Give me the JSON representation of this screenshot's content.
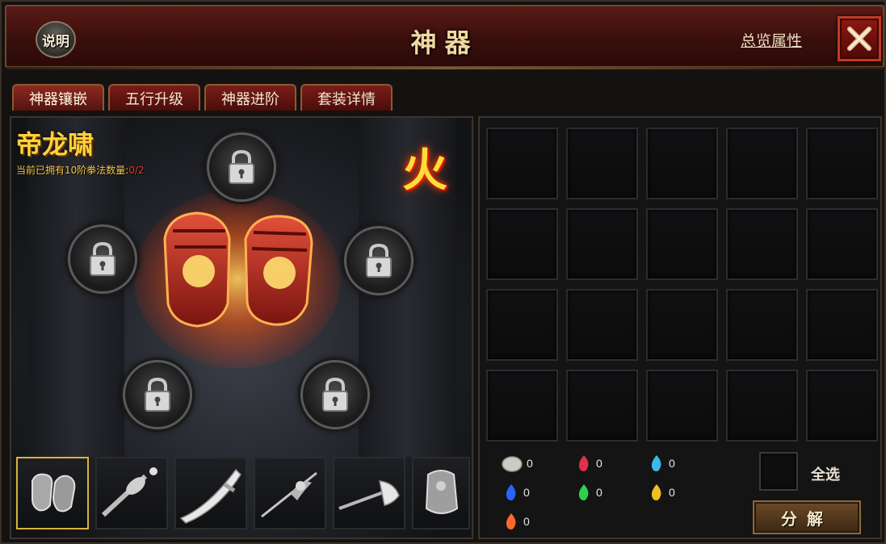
{
  "header": {
    "help_label": "说明",
    "title": "神器",
    "overview_link": "总览属性",
    "close_icon": "close-x-icon"
  },
  "tabs": [
    {
      "label": "神器镶嵌",
      "active": true
    },
    {
      "label": "五行升级",
      "active": false
    },
    {
      "label": "神器进阶",
      "active": false
    },
    {
      "label": "套装详情",
      "active": false
    }
  ],
  "artifact": {
    "name": "帝龙啸",
    "owned_prefix": "当前已拥有10阶拳法数量:",
    "owned_count": "0/2",
    "element": "火",
    "image_icon": "fire-gauntlets-icon",
    "sockets": [
      "lock-icon",
      "lock-icon",
      "lock-icon",
      "lock-icon",
      "lock-icon"
    ]
  },
  "thumbnails": [
    {
      "icon": "gauntlets-icon",
      "selected": true
    },
    {
      "icon": "mace-icon",
      "selected": false
    },
    {
      "icon": "blade-icon",
      "selected": false
    },
    {
      "icon": "staff-icon",
      "selected": false
    },
    {
      "icon": "axe-icon",
      "selected": false
    },
    {
      "icon": "armor-icon",
      "selected": false
    }
  ],
  "inventory": {
    "rows": 4,
    "cols": 5
  },
  "materials": [
    {
      "icon": "white-stone-icon",
      "count": "0",
      "color": "#cfcbc4"
    },
    {
      "icon": "red-flame-icon",
      "count": "0",
      "color": "#e0304a"
    },
    {
      "icon": "cyan-flame-icon",
      "count": "0",
      "color": "#3fb8e8"
    },
    {
      "icon": "blue-flame-icon",
      "count": "0",
      "color": "#2a64ff"
    },
    {
      "icon": "green-flame-icon",
      "count": "0",
      "color": "#2ed04a"
    },
    {
      "icon": "yellow-flame-icon",
      "count": "0",
      "color": "#f0c020"
    },
    {
      "icon": "orange-flame-icon",
      "count": "0",
      "color": "#ff6a2a"
    }
  ],
  "actions": {
    "select_all_label": "全选",
    "decompose_label": "分解"
  }
}
